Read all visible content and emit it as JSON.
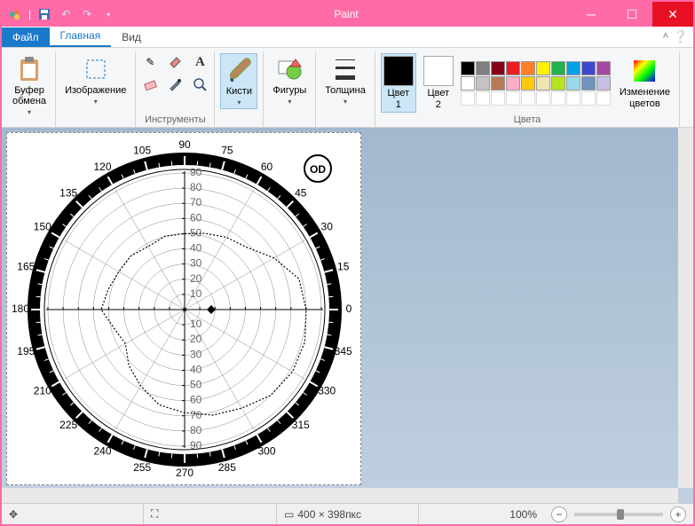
{
  "window": {
    "title": "Paint"
  },
  "tabs": {
    "file": "Файл",
    "home": "Главная",
    "view": "Вид"
  },
  "ribbon": {
    "clipboard": {
      "label": "Буфер\nобмена",
      "group": ""
    },
    "image": {
      "label": "Изображение",
      "group": ""
    },
    "tools": {
      "group": "Инструменты"
    },
    "brushes": {
      "label": "Кисти"
    },
    "shapes": {
      "label": "Фигуры"
    },
    "thickness": {
      "label": "Толщина"
    },
    "color1": {
      "label": "Цвет\n1"
    },
    "color2": {
      "label": "Цвет\n2"
    },
    "colors_group": "Цвета",
    "edit_colors": {
      "label": "Изменение\nцветов"
    },
    "palette_row1": [
      "#000000",
      "#7f7f7f",
      "#880015",
      "#ed1c24",
      "#ff7f27",
      "#fff200",
      "#22b14c",
      "#00a2e8",
      "#3f48cc",
      "#a349a4"
    ],
    "palette_row2": [
      "#ffffff",
      "#c3c3c3",
      "#b97a57",
      "#ffaec9",
      "#ffc90e",
      "#efe4b0",
      "#b5e61d",
      "#99d9ea",
      "#7092be",
      "#c8bfe7"
    ],
    "palette_row3": [
      "",
      "",
      "",
      "",
      "",
      "",
      "",
      "",
      "",
      ""
    ]
  },
  "status": {
    "dimensions": "400 × 398пкс",
    "zoom": "100%"
  },
  "chart_data": {
    "type": "polar",
    "title": "",
    "eye_label": "OD",
    "angle_labels": [
      0,
      15,
      30,
      45,
      60,
      75,
      90,
      105,
      120,
      135,
      150,
      165,
      180,
      195,
      210,
      225,
      240,
      255,
      270,
      285,
      300,
      315,
      330,
      345
    ],
    "radial_axis_values": [
      10,
      20,
      30,
      40,
      50,
      60,
      70,
      80,
      90
    ],
    "isopter_points_deg_to_radius": {
      "0": 80,
      "15": 78,
      "30": 68,
      "45": 58,
      "60": 55,
      "75": 52,
      "90": 50,
      "105": 50,
      "120": 48,
      "135": 50,
      "150": 50,
      "165": 52,
      "180": 55,
      "195": 48,
      "210": 45,
      "225": 52,
      "240": 58,
      "255": 65,
      "270": 68,
      "285": 72,
      "300": 75,
      "315": 80,
      "330": 82,
      "345": 82
    },
    "grid_circles": [
      10,
      20,
      30,
      40,
      50,
      60,
      70,
      80,
      90
    ],
    "center_marker": true
  }
}
